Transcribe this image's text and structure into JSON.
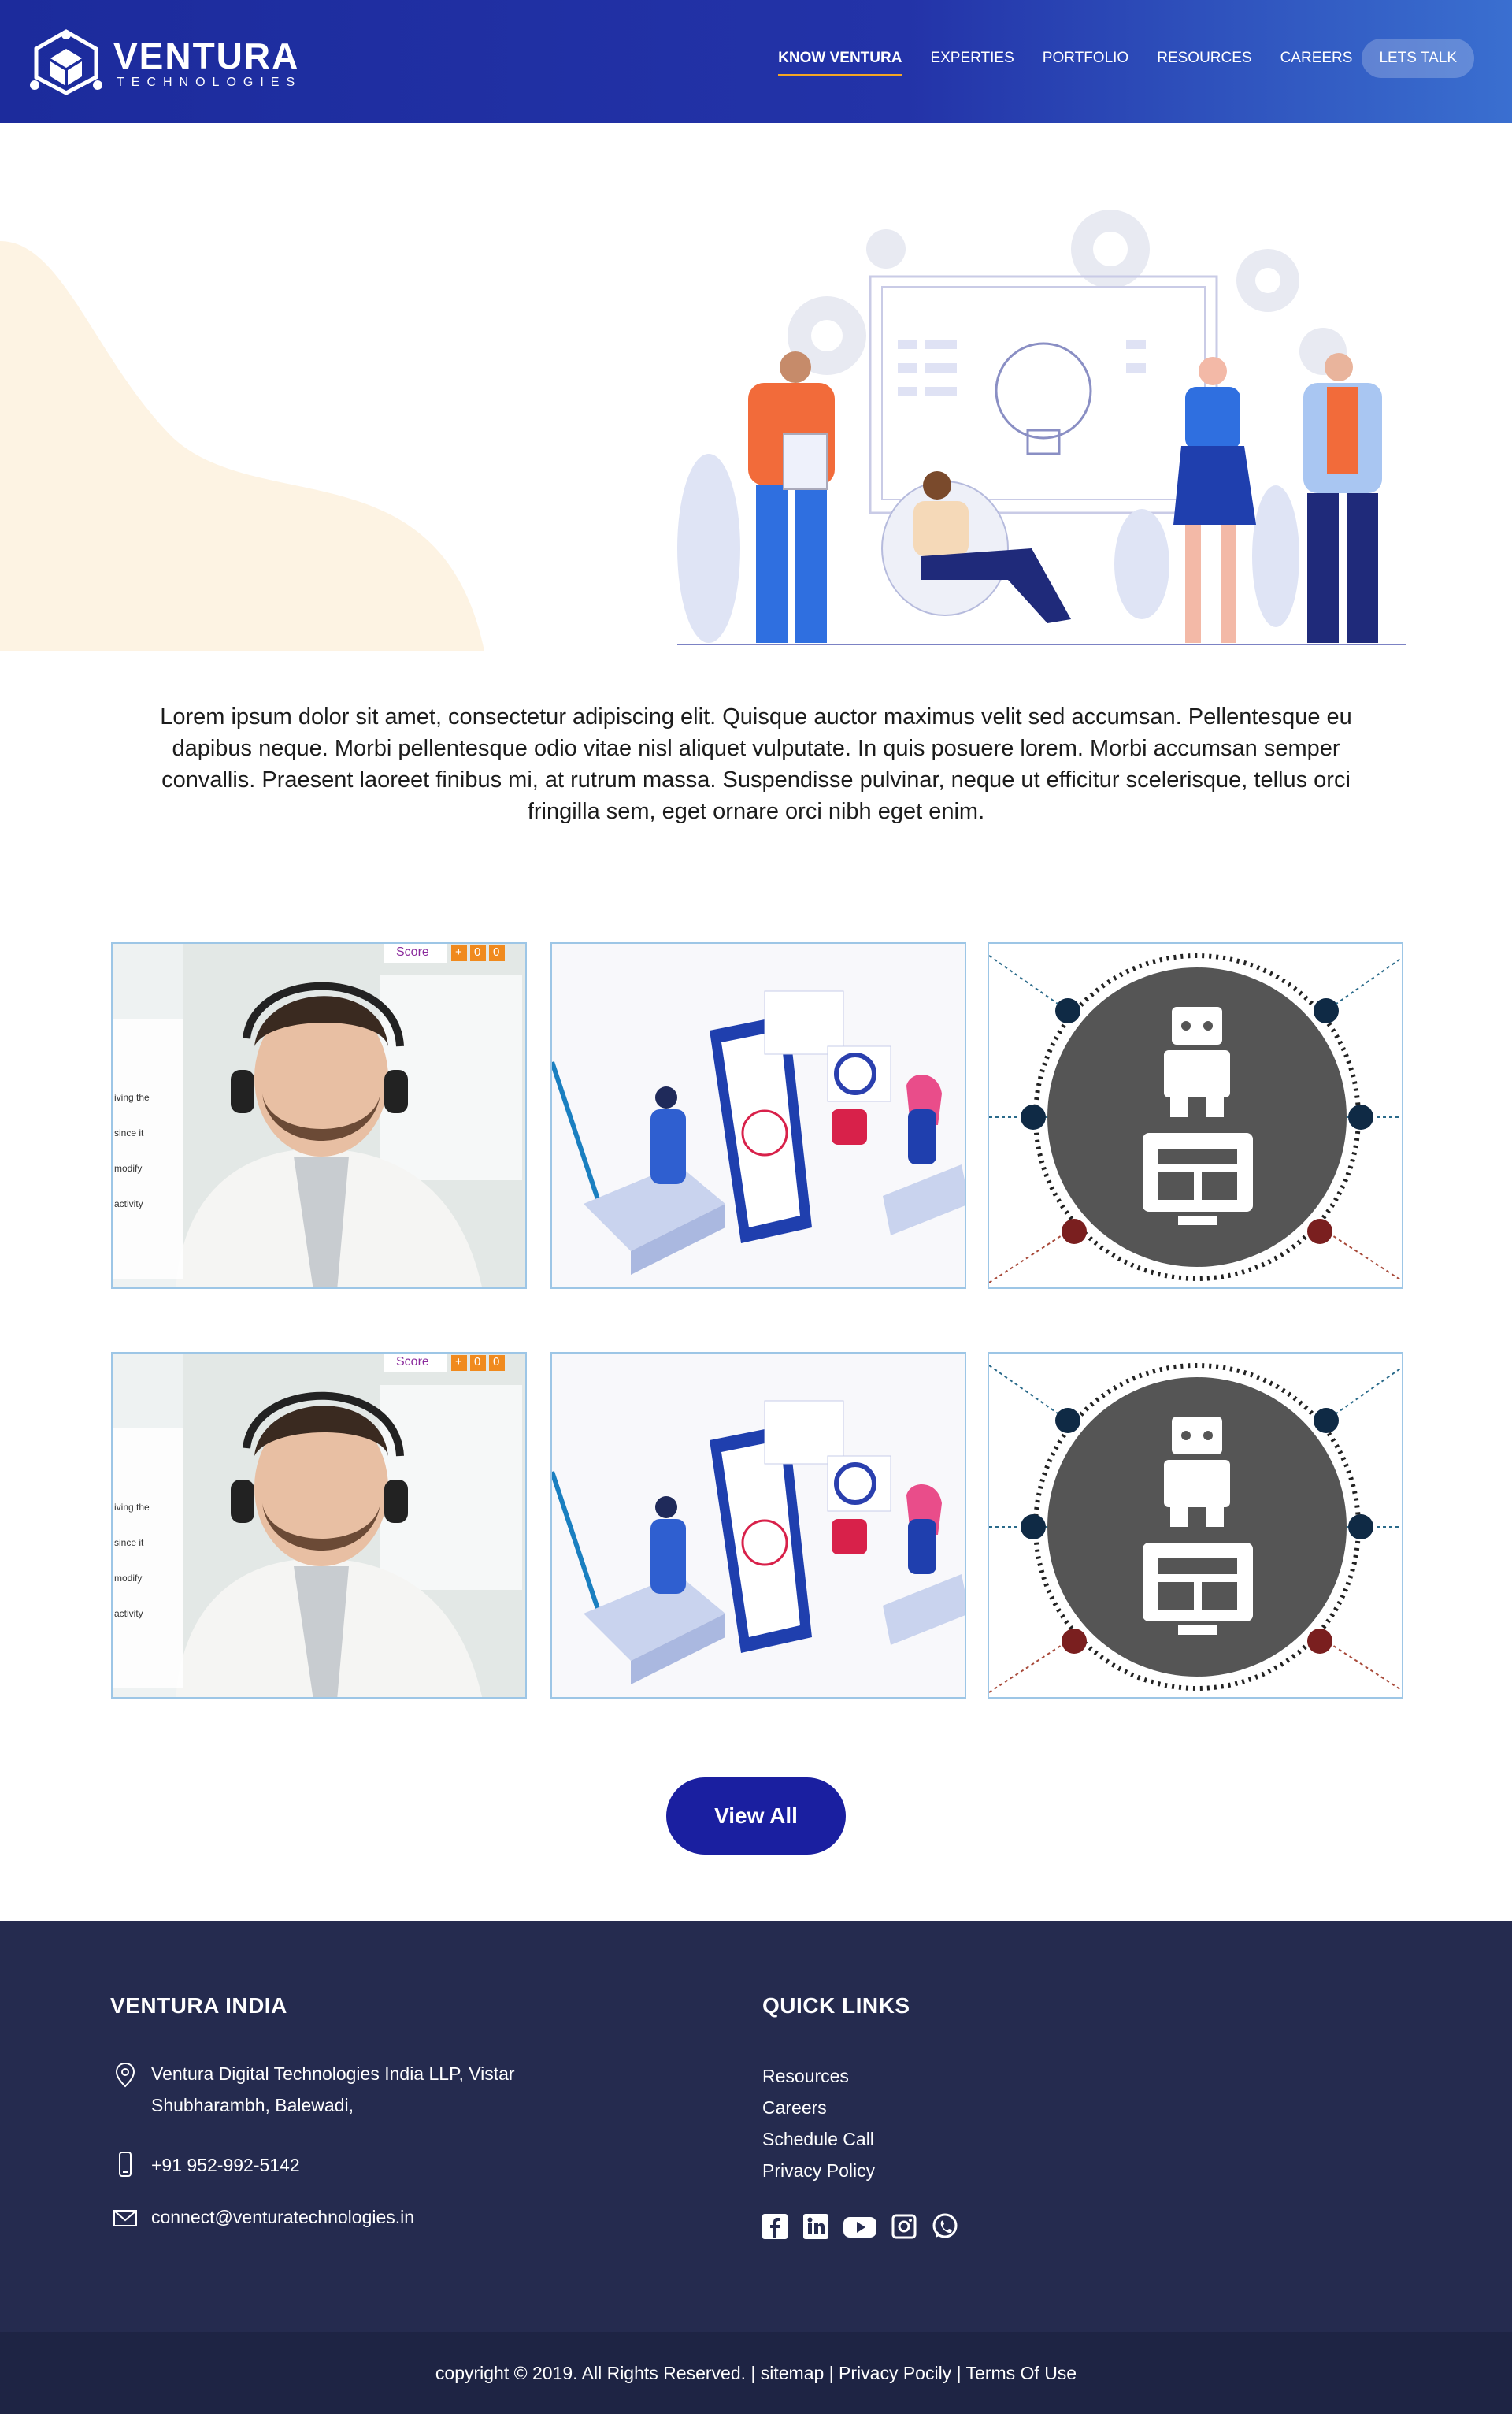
{
  "brand": {
    "name": "VENTURA",
    "tagline": "TECHNOLOGIES"
  },
  "nav": {
    "items": [
      {
        "label": "KNOW VENTURA",
        "active": true
      },
      {
        "label": "EXPERTIES"
      },
      {
        "label": "PORTFOLIO"
      },
      {
        "label": "RESOURCES"
      },
      {
        "label": "CAREERS"
      }
    ],
    "cta": "LETS TALK"
  },
  "intro": "Lorem ipsum dolor sit amet, consectetur adipiscing elit. Quisque auctor maximus velit sed accumsan. Pellentesque eu dapibus neque. Morbi pellentesque odio vitae nisl aliquet vulputate. In quis posuere lorem. Morbi accumsan semper convallis. Praesent laoreet finibus mi, at rutrum massa. Suspendisse pulvinar, neque ut efficitur scelerisque, tellus orci fringilla sem, eget ornare orci nibh eget enim.",
  "cards": {
    "agent": {
      "score_label": "Score",
      "score_plus": "+",
      "score_a": "0",
      "score_b": "0",
      "lines": [
        "iving the",
        "since it",
        "modify",
        "activity"
      ]
    }
  },
  "view_all": "View All",
  "footer": {
    "left_heading": "VENTURA INDIA",
    "address_line1": "Ventura Digital Technologies India LLP, Vistar",
    "address_line2": "Shubharambh, Balewadi,",
    "phone": "+91 952-992-5142",
    "email": "connect@venturatechnologies.in",
    "right_heading": "QUICK LINKS",
    "links": [
      "Resources",
      "Careers",
      "Schedule Call",
      "Privacy Policy"
    ],
    "social": [
      "facebook-icon",
      "linkedin-icon",
      "youtube-icon",
      "instagram-icon",
      "whatsapp-icon"
    ]
  },
  "copyright": "copyright © 2019. All Rights Reserved. | sitemap | Privacy Pocily | Terms Of Use",
  "colors": {
    "nav": "#1c2b9c",
    "accent": "#f5a623",
    "button": "#1a1fa0",
    "footer": "#252b4f",
    "footer_bottom": "#1e2444",
    "card_border": "#9dc6e6"
  }
}
